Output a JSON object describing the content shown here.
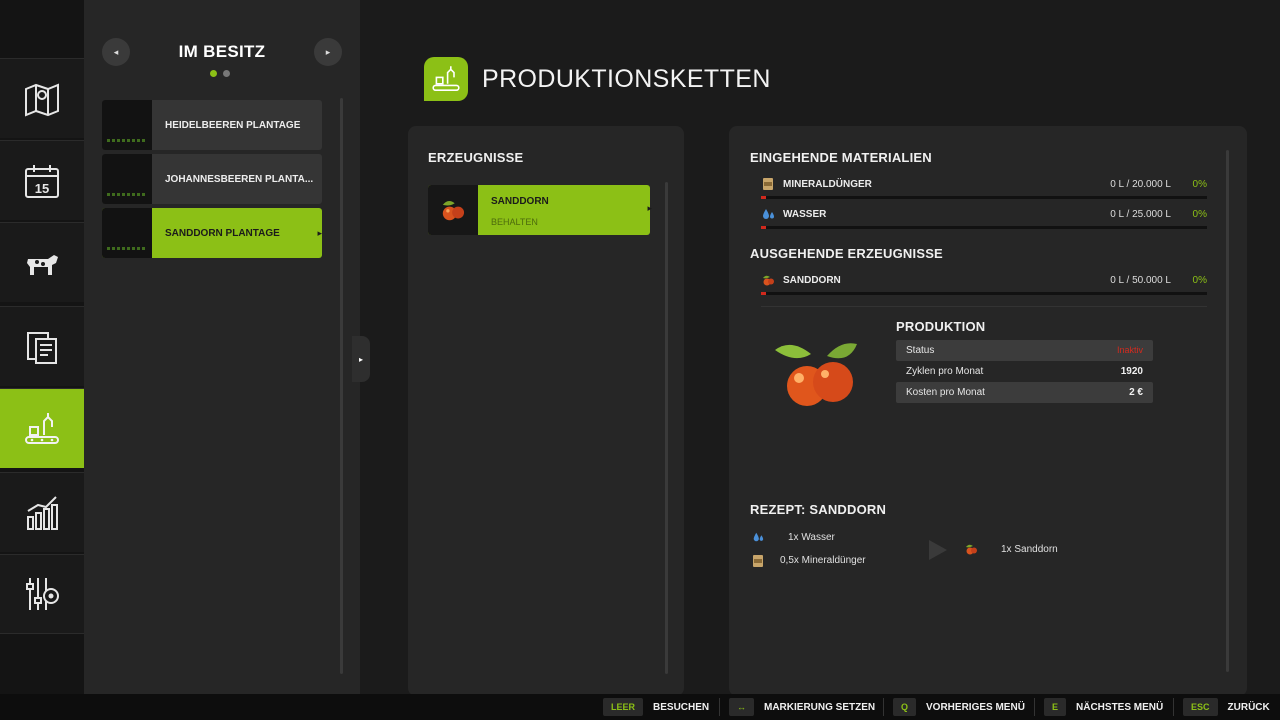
{
  "sidebar": {
    "items": [
      {
        "icon": "map-icon"
      },
      {
        "icon": "calendar-icon",
        "date_label": "15"
      },
      {
        "icon": "animals-icon"
      },
      {
        "icon": "contracts-icon"
      },
      {
        "icon": "production-icon",
        "active": true
      },
      {
        "icon": "statistics-icon"
      },
      {
        "icon": "settings-icon"
      }
    ]
  },
  "owned": {
    "title": "IM BESITZ",
    "prev_arrow": "◂",
    "next_arrow": "▸",
    "items": [
      {
        "label": "HEIDELBEEREN PLANTAGE"
      },
      {
        "label": "JOHANNESBEEREN PLANTA..."
      },
      {
        "label": "SANDDORN PLANTAGE"
      }
    ]
  },
  "header": {
    "title": "PRODUKTIONSKETTEN"
  },
  "products": {
    "title": "ERZEUGNISSE",
    "item": {
      "name": "SANDDORN",
      "sub": "BEHALTEN"
    }
  },
  "details": {
    "incoming_title": "EINGEHENDE MATERIALIEN",
    "incoming": [
      {
        "name": "MINERALDÜNGER",
        "amount": "0 L / 20.000 L",
        "percent": "0%"
      },
      {
        "name": "WASSER",
        "amount": "0 L / 25.000 L",
        "percent": "0%"
      }
    ],
    "outgoing_title": "AUSGEHENDE ERZEUGNISSE",
    "outgoing": [
      {
        "name": "SANDDORN",
        "amount": "0 L / 50.000 L",
        "percent": "0%"
      }
    ],
    "production": {
      "title": "PRODUKTION",
      "status_label": "Status",
      "status_value": "Inaktiv",
      "cycles_label": "Zyklen pro Monat",
      "cycles_value": "1920",
      "cost_label": "Kosten pro Monat",
      "cost_value": "2 €"
    },
    "recipe": {
      "title": "REZEPT: SANDDORN",
      "inputs": [
        "1x Wasser",
        "0,5x Mineraldünger"
      ],
      "output": "1x Sanddorn"
    }
  },
  "footer": {
    "hints": [
      {
        "key": "LEER",
        "label": "BESUCHEN"
      },
      {
        "key": "↔",
        "label": "MARKIERUNG SETZEN"
      },
      {
        "key": "Q",
        "label": "VORHERIGES MENÜ"
      },
      {
        "key": "E",
        "label": "NÄCHSTES MENÜ"
      },
      {
        "key": "ESC",
        "label": "ZURÜCK"
      }
    ]
  },
  "colors": {
    "accent": "#8cc016",
    "warning": "#d32b1f",
    "panel": "#262626",
    "background": "#1b1b1b"
  }
}
